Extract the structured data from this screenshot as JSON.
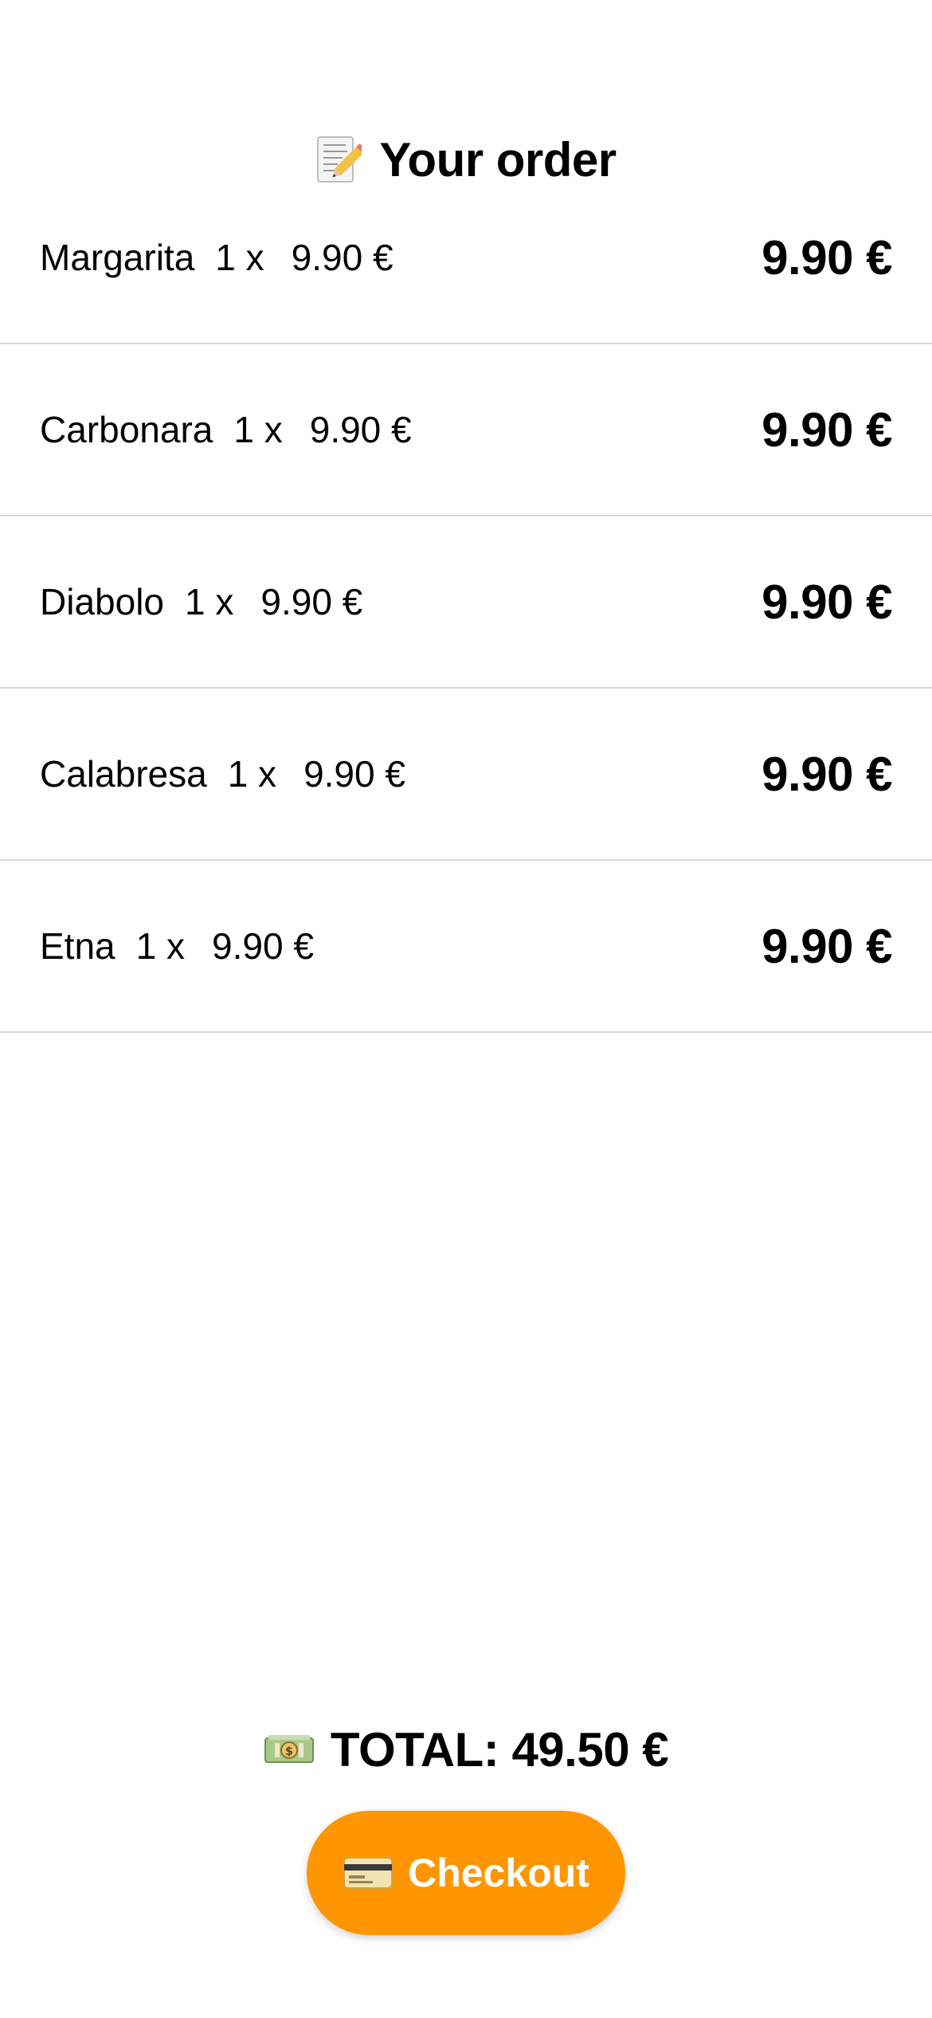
{
  "header": {
    "icon": "memo-icon",
    "title": "Your order"
  },
  "order": {
    "items": [
      {
        "name": "Margarita",
        "qty": "1 x",
        "unit_price": "9.90 €",
        "total": "9.90 €"
      },
      {
        "name": "Carbonara",
        "qty": "1 x",
        "unit_price": "9.90 €",
        "total": "9.90 €"
      },
      {
        "name": "Diabolo",
        "qty": "1 x",
        "unit_price": "9.90 €",
        "total": "9.90 €"
      },
      {
        "name": "Calabresa",
        "qty": "1 x",
        "unit_price": "9.90 €",
        "total": "9.90 €"
      },
      {
        "name": "Etna",
        "qty": "1 x",
        "unit_price": "9.90 €",
        "total": "9.90 €"
      }
    ]
  },
  "summary": {
    "icon": "money-icon",
    "total_text": "TOTAL: 49.50 €"
  },
  "checkout": {
    "icon": "credit-card-icon",
    "label": "Checkout",
    "color": "#FF9500"
  }
}
